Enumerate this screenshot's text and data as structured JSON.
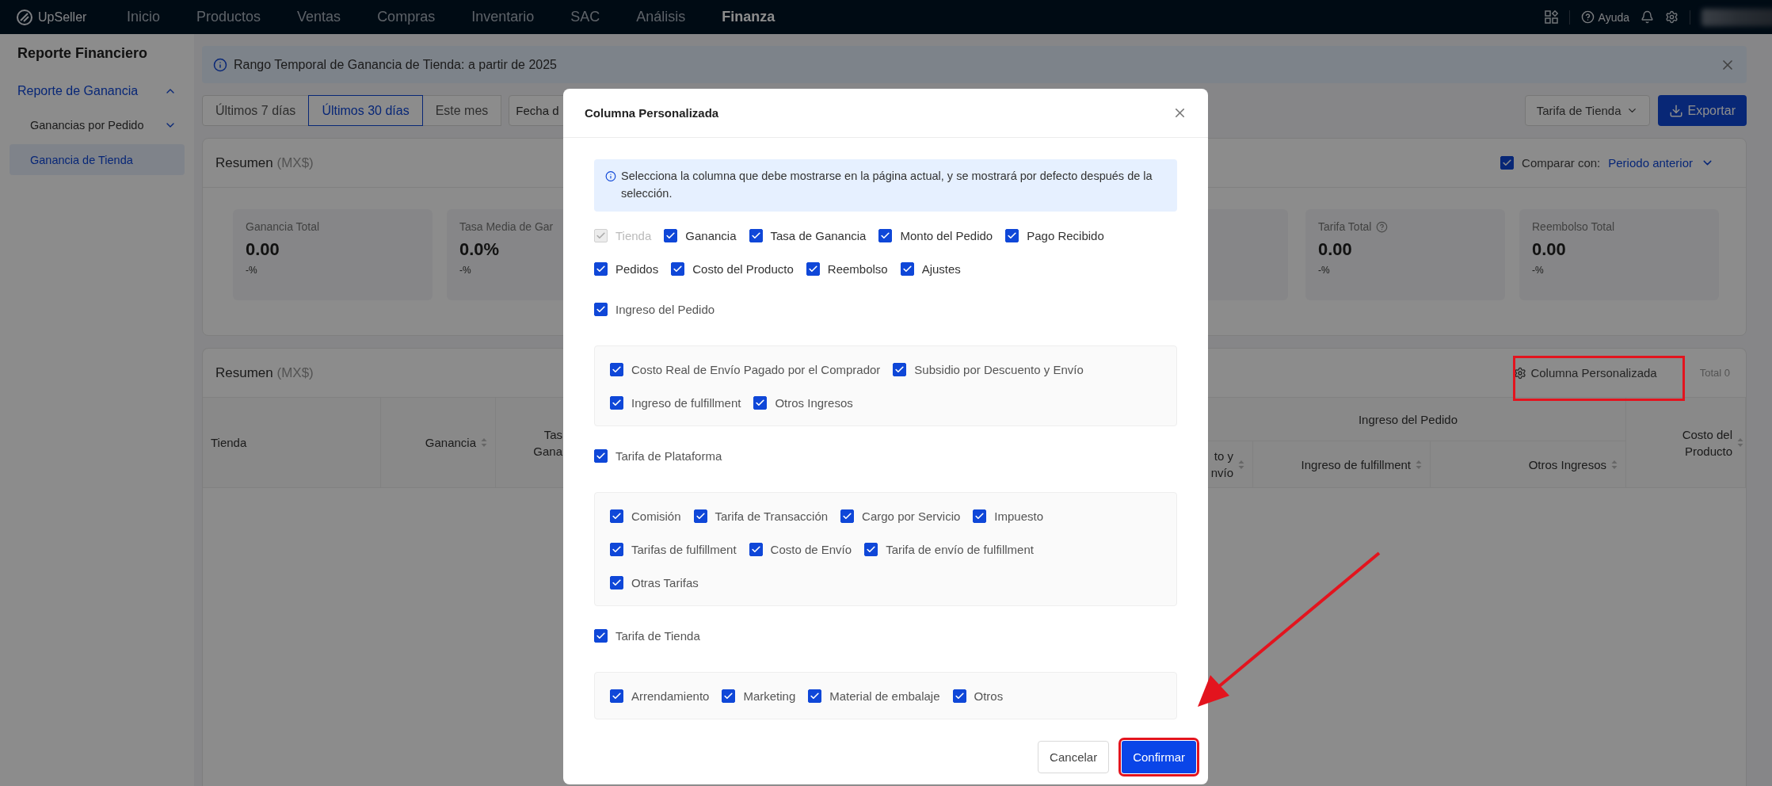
{
  "nav": {
    "logo": "UpSeller",
    "items": [
      {
        "label": "Inicio",
        "selected": false
      },
      {
        "label": "Productos",
        "selected": false
      },
      {
        "label": "Ventas",
        "selected": false
      },
      {
        "label": "Compras",
        "selected": false
      },
      {
        "label": "Inventario",
        "selected": false
      },
      {
        "label": "SAC",
        "selected": false
      },
      {
        "label": "Análisis",
        "selected": false
      },
      {
        "label": "Finanza",
        "selected": true
      }
    ],
    "help": "Ayuda"
  },
  "sidebar": {
    "title": "Reporte Financiero",
    "items": [
      {
        "label": "Reporte de Ganancia",
        "selected": true,
        "expanded": true,
        "children": [
          {
            "label": "Ganancias por Pedido",
            "kind": "group",
            "expanded": false,
            "selected": false
          },
          {
            "label": "Ganancia de Tienda",
            "kind": "link",
            "selected": true
          }
        ]
      }
    ]
  },
  "notice": {
    "text": "Rango Temporal de Ganancia de Tienda: a partir de 2025"
  },
  "toolbar": {
    "ranges": [
      {
        "label": "Últimos 7 días",
        "selected": false
      },
      {
        "label": "Últimos 30 días",
        "selected": true
      },
      {
        "label": "Este mes",
        "selected": false
      }
    ],
    "date_field": "Fecha d",
    "fee_select": "Tarifa de Tienda",
    "export": "Exportar"
  },
  "summary": {
    "title": "Resumen",
    "currency": "(MX$)",
    "compare": {
      "checked": true,
      "label": "Comparar con:",
      "value": "Periodo anterior"
    },
    "cards_left": [
      {
        "label": "Ganancia Total",
        "value": "0.00",
        "change": "-%",
        "help": false
      },
      {
        "label": "Tasa Media de Gar",
        "value": "0.0%",
        "change": "-%",
        "help": false
      }
    ],
    "cards_right": [
      {
        "label": "Tarifa Total",
        "value": "0.00",
        "change": "-%",
        "help": true
      },
      {
        "label": "Reembolso Total",
        "value": "0.00",
        "change": "-%",
        "help": false
      }
    ]
  },
  "table": {
    "title": "Resumen",
    "currency": "(MX$)",
    "custom_columns": "Columna Personalizada",
    "total": "Total 0",
    "columns": [
      {
        "label": "Tienda",
        "sortable": false
      },
      {
        "label": "Ganancia",
        "sortable": true
      },
      {
        "label": "Tas Gana",
        "sortable": false
      }
    ],
    "group": {
      "label": "Ingreso del Pedido",
      "columns": [
        {
          "label": "to y nvío",
          "sortable": true
        },
        {
          "label": "Ingreso de fulfillment",
          "sortable": true
        },
        {
          "label": "Otros Ingresos",
          "sortable": true
        }
      ]
    },
    "trailing_columns": [
      {
        "label": "Costo del Producto",
        "sortable": true
      }
    ]
  },
  "modal": {
    "title": "Columna Personalizada",
    "notice": "Selecciona la columna que debe mostrarse en la página actual, y se mostrará por defecto después de la selección.",
    "basic": [
      {
        "label": "Tienda",
        "checked": true,
        "disabled": true
      },
      {
        "label": "Ganancia",
        "checked": true,
        "disabled": false
      },
      {
        "label": "Tasa de Ganancia",
        "checked": true,
        "disabled": false
      },
      {
        "label": "Monto del Pedido",
        "checked": true,
        "disabled": false
      },
      {
        "label": "Pago Recibido",
        "checked": true,
        "disabled": false
      },
      {
        "label": "Pedidos",
        "checked": true,
        "disabled": false
      },
      {
        "label": "Costo del Producto",
        "checked": true,
        "disabled": false
      },
      {
        "label": "Reembolso",
        "checked": true,
        "disabled": false
      },
      {
        "label": "Ajustes",
        "checked": true,
        "disabled": false
      }
    ],
    "groups": [
      {
        "label": "Ingreso del Pedido",
        "checked": true,
        "options": [
          {
            "label": "Costo Real de Envío Pagado por el Comprador",
            "checked": true
          },
          {
            "label": "Subsidio por Descuento y Envío",
            "checked": true
          },
          {
            "label": "Ingreso de fulfillment",
            "checked": true
          },
          {
            "label": "Otros Ingresos",
            "checked": true
          }
        ]
      },
      {
        "label": "Tarifa de Plataforma",
        "checked": true,
        "options": [
          {
            "label": "Comisión",
            "checked": true
          },
          {
            "label": "Tarifa de Transacción",
            "checked": true
          },
          {
            "label": "Cargo por Servicio",
            "checked": true
          },
          {
            "label": "Impuesto",
            "checked": true
          },
          {
            "label": "Tarifas de fulfillment",
            "checked": true
          },
          {
            "label": "Costo de Envío",
            "checked": true
          },
          {
            "label": "Tarifa de envío de fulfillment",
            "checked": true
          },
          {
            "label": "Otras Tarifas",
            "checked": true
          }
        ]
      },
      {
        "label": "Tarifa de Tienda",
        "checked": true,
        "options": [
          {
            "label": "Arrendamiento",
            "checked": true
          },
          {
            "label": "Marketing",
            "checked": true
          },
          {
            "label": "Material de embalaje",
            "checked": true
          },
          {
            "label": "Otros",
            "checked": true
          }
        ]
      }
    ],
    "cancel": "Cancelar",
    "confirm": "Confirmar"
  }
}
